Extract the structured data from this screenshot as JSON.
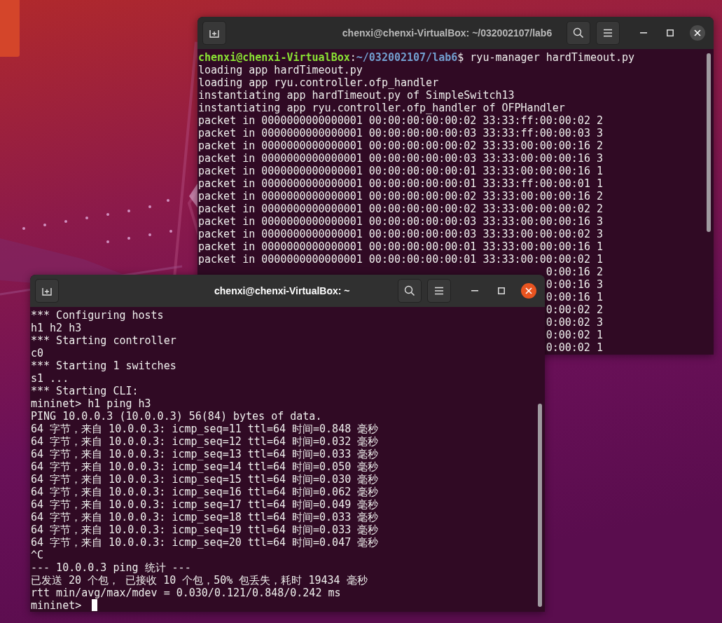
{
  "desktop": {
    "windows": [
      {
        "title": "chenxi@chenxi-VirtualBox: ~/032002107/lab6",
        "focused": false,
        "lines": [
          {
            "kind": "prompt",
            "user_host": "chenxi@chenxi-VirtualBox",
            "separator": ":",
            "path": "~/032002107/lab6",
            "command": "$ ryu-manager hardTimeout.py"
          },
          {
            "kind": "text",
            "text": "loading app hardTimeout.py"
          },
          {
            "kind": "text",
            "text": "loading app ryu.controller.ofp_handler"
          },
          {
            "kind": "text",
            "text": "instantiating app hardTimeout.py of SimpleSwitch13"
          },
          {
            "kind": "text",
            "text": "instantiating app ryu.controller.ofp_handler of OFPHandler"
          },
          {
            "kind": "text",
            "text": "packet in 0000000000000001 00:00:00:00:00:02 33:33:ff:00:00:02 2"
          },
          {
            "kind": "text",
            "text": "packet in 0000000000000001 00:00:00:00:00:03 33:33:ff:00:00:03 3"
          },
          {
            "kind": "text",
            "text": "packet in 0000000000000001 00:00:00:00:00:02 33:33:00:00:00:16 2"
          },
          {
            "kind": "text",
            "text": "packet in 0000000000000001 00:00:00:00:00:03 33:33:00:00:00:16 3"
          },
          {
            "kind": "text",
            "text": "packet in 0000000000000001 00:00:00:00:00:01 33:33:00:00:00:16 1"
          },
          {
            "kind": "text",
            "text": "packet in 0000000000000001 00:00:00:00:00:01 33:33:ff:00:00:01 1"
          },
          {
            "kind": "text",
            "text": "packet in 0000000000000001 00:00:00:00:00:02 33:33:00:00:00:16 2"
          },
          {
            "kind": "text",
            "text": "packet in 0000000000000001 00:00:00:00:00:02 33:33:00:00:00:02 2"
          },
          {
            "kind": "text",
            "text": "packet in 0000000000000001 00:00:00:00:00:03 33:33:00:00:00:16 3"
          },
          {
            "kind": "text",
            "text": "packet in 0000000000000001 00:00:00:00:00:03 33:33:00:00:00:02 3"
          },
          {
            "kind": "text",
            "text": "packet in 0000000000000001 00:00:00:00:00:01 33:33:00:00:00:16 1"
          },
          {
            "kind": "text",
            "text": "packet in 0000000000000001 00:00:00:00:00:01 33:33:00:00:00:02 1"
          },
          {
            "kind": "tail",
            "text": "0:00:16 2"
          },
          {
            "kind": "tail",
            "text": "0:00:16 3"
          },
          {
            "kind": "tail",
            "text": "0:00:16 1"
          },
          {
            "kind": "tail",
            "text": "0:00:02 2"
          },
          {
            "kind": "tail",
            "text": "0:00:02 3"
          },
          {
            "kind": "tail",
            "text": "0:00:02 1"
          },
          {
            "kind": "tail",
            "text": "0:00:02 1"
          }
        ]
      },
      {
        "title": "chenxi@chenxi-VirtualBox: ~",
        "focused": true,
        "lines": [
          {
            "kind": "text",
            "text": "*** Configuring hosts"
          },
          {
            "kind": "text",
            "text": "h1 h2 h3"
          },
          {
            "kind": "text",
            "text": "*** Starting controller"
          },
          {
            "kind": "text",
            "text": "c0"
          },
          {
            "kind": "text",
            "text": "*** Starting 1 switches"
          },
          {
            "kind": "text",
            "text": "s1 ..."
          },
          {
            "kind": "text",
            "text": "*** Starting CLI:"
          },
          {
            "kind": "text",
            "text": "mininet> h1 ping h3"
          },
          {
            "kind": "text",
            "text": "PING 10.0.0.3 (10.0.0.3) 56(84) bytes of data."
          },
          {
            "kind": "text",
            "text": "64 字节，来自 10.0.0.3: icmp_seq=11 ttl=64 时间=0.848 毫秒"
          },
          {
            "kind": "text",
            "text": "64 字节，来自 10.0.0.3: icmp_seq=12 ttl=64 时间=0.032 毫秒"
          },
          {
            "kind": "text",
            "text": "64 字节，来自 10.0.0.3: icmp_seq=13 ttl=64 时间=0.033 毫秒"
          },
          {
            "kind": "text",
            "text": "64 字节，来自 10.0.0.3: icmp_seq=14 ttl=64 时间=0.050 毫秒"
          },
          {
            "kind": "text",
            "text": "64 字节，来自 10.0.0.3: icmp_seq=15 ttl=64 时间=0.030 毫秒"
          },
          {
            "kind": "text",
            "text": "64 字节，来自 10.0.0.3: icmp_seq=16 ttl=64 时间=0.062 毫秒"
          },
          {
            "kind": "text",
            "text": "64 字节，来自 10.0.0.3: icmp_seq=17 ttl=64 时间=0.049 毫秒"
          },
          {
            "kind": "text",
            "text": "64 字节，来自 10.0.0.3: icmp_seq=18 ttl=64 时间=0.033 毫秒"
          },
          {
            "kind": "text",
            "text": "64 字节，来自 10.0.0.3: icmp_seq=19 ttl=64 时间=0.033 毫秒"
          },
          {
            "kind": "text",
            "text": "64 字节，来自 10.0.0.3: icmp_seq=20 ttl=64 时间=0.047 毫秒"
          },
          {
            "kind": "text",
            "text": "^C"
          },
          {
            "kind": "text",
            "text": "--- 10.0.0.3 ping 统计 ---"
          },
          {
            "kind": "text",
            "text": "已发送 20 个包， 已接收 10 个包，50% 包丢失，耗时 19434 毫秒"
          },
          {
            "kind": "text",
            "text": "rtt min/avg/max/mdev = 0.030/0.121/0.848/0.242 ms"
          },
          {
            "kind": "input",
            "text": "mininet>",
            "cursor": true
          }
        ]
      }
    ]
  }
}
